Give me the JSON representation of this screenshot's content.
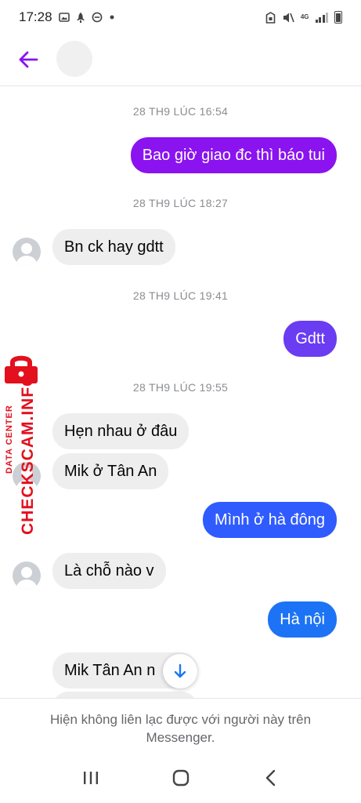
{
  "status_bar": {
    "time": "17:28",
    "left_icons": [
      "image-icon",
      "rocket-icon",
      "do-not-disturb-icon",
      "dot-icon"
    ],
    "network_label": "4G",
    "right_icons": [
      "alarm-lock-icon",
      "mute-icon",
      "signal-icon",
      "battery-icon"
    ]
  },
  "header": {
    "back_icon": "arrow-left-icon",
    "accent_color": "#8a13f0"
  },
  "messages": [
    {
      "kind": "timestamp",
      "text": "28 TH9 LÚC 16:54"
    },
    {
      "kind": "outgoing",
      "text": "Bao giờ giao đc thì báo tui",
      "color": "#8a13f0"
    },
    {
      "kind": "timestamp",
      "text": "28 TH9 LÚC 18:27"
    },
    {
      "kind": "incoming",
      "text": "Bn ck hay gdtt"
    },
    {
      "kind": "timestamp",
      "text": "28 TH9 LÚC 19:41"
    },
    {
      "kind": "outgoing",
      "text": "Gdtt",
      "color": "#6a3cf2"
    },
    {
      "kind": "timestamp",
      "text": "28 TH9 LÚC 19:55"
    },
    {
      "kind": "incoming",
      "text": "Hẹn nhau ở đâu"
    },
    {
      "kind": "incoming",
      "text": "Mik ở Tân An"
    },
    {
      "kind": "outgoing",
      "text": "Mình ở hà đông",
      "color": "#2f5bff"
    },
    {
      "kind": "incoming",
      "text": "Là chỗ nào v"
    },
    {
      "kind": "outgoing",
      "text": "Hà nội",
      "color": "#1d73f5"
    },
    {
      "kind": "incoming",
      "text": "Mik Tân An n"
    }
  ],
  "scroll_down_icon": "arrow-down-icon",
  "watermark": {
    "brand": "CHECKSCAM.INFO",
    "subtitle": "DATA CENTER",
    "color": "#e3101e"
  },
  "footer": {
    "notice": "Hiện không liên lạc được với người này trên Messenger."
  },
  "nav_bar": {
    "recents_icon": "recents-icon",
    "home_icon": "home-icon",
    "back_icon": "back-chevron-icon"
  }
}
